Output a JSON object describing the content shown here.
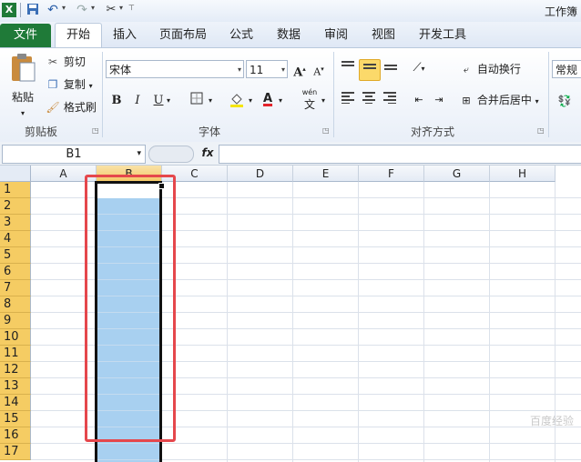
{
  "window": {
    "title": "工作簿"
  },
  "quick_access": {
    "icons": [
      "excel-logo-icon",
      "save-icon",
      "undo-icon",
      "redo-icon",
      "customize-tool-icon"
    ]
  },
  "tabs": [
    {
      "label": "文件"
    },
    {
      "label": "开始"
    },
    {
      "label": "插入"
    },
    {
      "label": "页面布局"
    },
    {
      "label": "公式"
    },
    {
      "label": "数据"
    },
    {
      "label": "审阅"
    },
    {
      "label": "视图"
    },
    {
      "label": "开发工具"
    }
  ],
  "active_tab": "开始",
  "clipboard": {
    "paste": "粘贴",
    "cut": "剪切",
    "copy": "复制",
    "format_painter": "格式刷",
    "group_label": "剪贴板"
  },
  "font": {
    "name": "宋体",
    "size": "11",
    "bold": "B",
    "italic": "I",
    "underline": "U",
    "grow": "A",
    "shrink": "A",
    "color_glyph": "A",
    "phonetic_top": "wén",
    "phonetic_bottom": "文",
    "group_label": "字体"
  },
  "alignment": {
    "wrap_text": "自动换行",
    "merge_center": "合并后居中",
    "group_label": "对齐方式"
  },
  "number": {
    "format": "常规"
  },
  "formula_bar": {
    "name_box": "B1",
    "fx": "fx",
    "value": ""
  },
  "columns": [
    "A",
    "B",
    "C",
    "D",
    "E",
    "F",
    "G",
    "H"
  ],
  "rows": [
    "1",
    "2",
    "3",
    "4",
    "5",
    "6",
    "7",
    "8",
    "9",
    "10",
    "11",
    "12",
    "13",
    "14",
    "15",
    "16",
    "17"
  ],
  "selection": {
    "column": "B",
    "active_cell": "B1"
  },
  "colors": {
    "file_tab": "#1f7a38",
    "selection_fill": "#a8d0f0",
    "highlight_box": "#e5474c",
    "row_header": "#f5cc63"
  },
  "watermark": "百度经验"
}
